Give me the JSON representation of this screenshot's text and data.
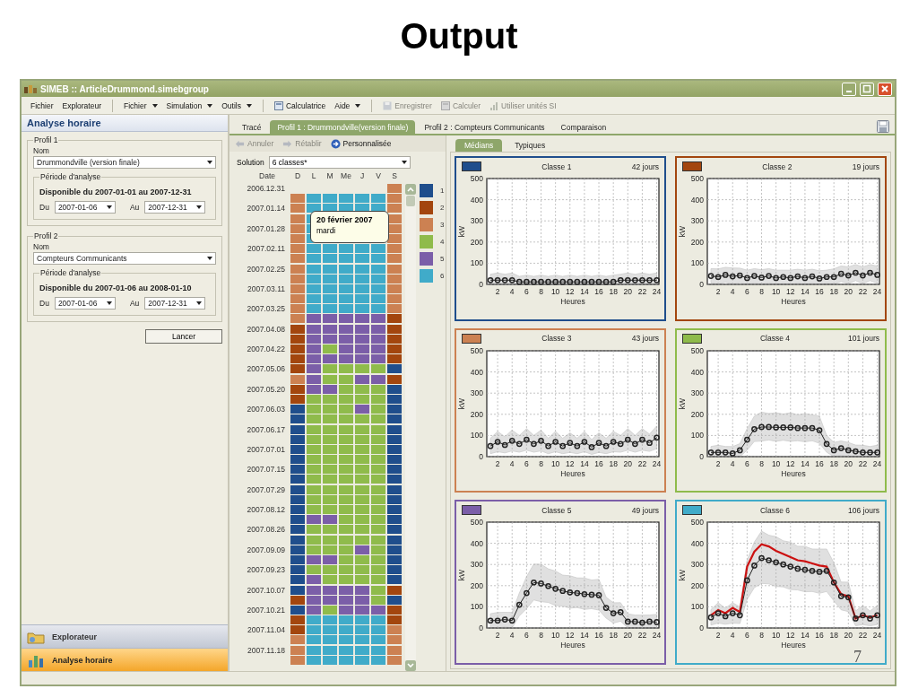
{
  "slide": {
    "title": "Output",
    "page_number": "7"
  },
  "window": {
    "title": "SIMEB :: ArticleDrummond.simebgroup"
  },
  "toolbar_groups": [
    [
      {
        "label": "Fichier",
        "kind": "plain",
        "disabled": false
      },
      {
        "label": "Explorateur",
        "kind": "plain",
        "disabled": false
      }
    ],
    [
      {
        "label": "Fichier",
        "kind": "menu",
        "disabled": false
      },
      {
        "label": "Simulation",
        "kind": "menu",
        "disabled": false
      },
      {
        "label": "Outils",
        "kind": "menu",
        "disabled": false
      }
    ],
    [
      {
        "label": "Calculatrice",
        "kind": "calculator",
        "disabled": false
      },
      {
        "label": "Aide",
        "kind": "menu",
        "disabled": false
      }
    ],
    [
      {
        "label": "Enregistrer",
        "kind": "save",
        "disabled": true
      },
      {
        "label": "Calculer",
        "kind": "calculator",
        "disabled": true
      },
      {
        "label": "Utiliser unités SI",
        "kind": "bars",
        "disabled": true
      }
    ]
  ],
  "left_panel": {
    "title": "Analyse horaire",
    "profiles": [
      {
        "legend": "Profil 1",
        "name_label": "Nom",
        "name_value": "Drummondville (version finale)",
        "period_legend": "Période d'analyse",
        "available": "Disponible du 2007-01-01 au 2007-12-31",
        "from_label": "Du",
        "from_value": "2007-01-06",
        "to_label": "Au",
        "to_value": "2007-12-31"
      },
      {
        "legend": "Profil 2",
        "name_label": "Nom",
        "name_value": "Compteurs Communicants",
        "period_legend": "Période d'analyse",
        "available": "Disponible du 2007-01-06 au 2008-01-10",
        "from_label": "Du",
        "from_value": "2007-01-06",
        "to_label": "Au",
        "to_value": "2007-12-31"
      }
    ],
    "run_button": "Lancer"
  },
  "nav": [
    {
      "label": "Explorateur",
      "selected": false
    },
    {
      "label": "Analyse horaire",
      "selected": true
    }
  ],
  "tabs": [
    {
      "label": "Tracé",
      "selected": false
    },
    {
      "label": "Profil 1 : Drummondville(version finale)",
      "selected": true
    },
    {
      "label": "Profil 2 : Compteurs Communicants",
      "selected": false
    },
    {
      "label": "Comparaison",
      "selected": false
    }
  ],
  "actions": [
    {
      "label": "Annuler",
      "kind": "undo",
      "disabled": true
    },
    {
      "label": "Rétablir",
      "kind": "redo",
      "disabled": true
    },
    {
      "label": "Personnalisée",
      "kind": "custom",
      "disabled": false
    }
  ],
  "solution": {
    "label": "Solution",
    "value": "6 classes*"
  },
  "calendar": {
    "date_header": "Date",
    "day_headers": [
      "D",
      "L",
      "M",
      "Me",
      "J",
      "V",
      "S"
    ],
    "weeks": [
      {
        "label": "2006.12.31",
        "end_days": [
          {
            "color": "#cc8152"
          }
        ]
      },
      {
        "days": [
          {
            "color": "#cc8152"
          },
          {
            "color": "#40abc9"
          },
          {
            "color": "#40abc9"
          },
          {
            "color": "#40abc9"
          },
          {
            "color": "#40abc9"
          },
          {
            "color": "#40abc9"
          },
          {
            "color": "#cc8152"
          }
        ]
      },
      {
        "label": "2007.01.14",
        "days": [
          {
            "color": "#cc8152"
          },
          {
            "color": "#40abc9"
          },
          {
            "color": "#40abc9"
          },
          {
            "color": "#40abc9"
          },
          {
            "color": "#40abc9"
          },
          {
            "color": "#40abc9"
          },
          {
            "color": "#cc8152"
          }
        ]
      },
      {
        "days": [
          {
            "color": "#cc8152"
          },
          {
            "color": "#40abc9"
          }
        ],
        "end_days": [
          {
            "color": "#cc8152"
          }
        ]
      },
      {
        "label": "2007.01.28",
        "days": [
          {
            "color": "#cc8152"
          },
          {
            "color": "#40abc9"
          }
        ],
        "end_days": [
          {
            "color": "#cc8152"
          }
        ]
      },
      {
        "days": [
          {
            "color": "#cc8152"
          },
          {
            "color": "#40abc9"
          }
        ],
        "end_days": [
          {
            "color": "#cc8152"
          }
        ]
      },
      {
        "label": "2007.02.11",
        "days": [
          {
            "color": "#cc8152"
          },
          {
            "color": "#40abc9"
          },
          {
            "color": "#40abc9"
          },
          {
            "color": "#40abc9"
          },
          {
            "color": "#40abc9"
          },
          {
            "color": "#40abc9"
          },
          {
            "color": "#cc8152"
          }
        ]
      },
      {
        "days": [
          {
            "color": "#cc8152"
          },
          {
            "color": "#40abc9"
          },
          {
            "color": "#40abc9"
          },
          {
            "color": "#40abc9"
          },
          {
            "color": "#40abc9"
          },
          {
            "color": "#40abc9"
          },
          {
            "color": "#cc8152"
          }
        ]
      },
      {
        "label": "2007.02.25",
        "days": [
          {
            "color": "#cc8152"
          },
          {
            "color": "#40abc9"
          },
          {
            "color": "#40abc9"
          },
          {
            "color": "#40abc9"
          },
          {
            "color": "#40abc9"
          },
          {
            "color": "#40abc9"
          },
          {
            "color": "#cc8152"
          }
        ]
      },
      {
        "days": [
          {
            "color": "#cc8152"
          },
          {
            "color": "#40abc9"
          },
          {
            "color": "#40abc9"
          },
          {
            "color": "#40abc9"
          },
          {
            "color": "#40abc9"
          },
          {
            "color": "#40abc9"
          },
          {
            "color": "#cc8152"
          }
        ]
      },
      {
        "label": "2007.03.11",
        "days": [
          {
            "color": "#cc8152"
          },
          {
            "color": "#40abc9"
          },
          {
            "color": "#40abc9"
          },
          {
            "color": "#40abc9"
          },
          {
            "color": "#40abc9"
          },
          {
            "color": "#40abc9"
          },
          {
            "color": "#cc8152"
          }
        ]
      },
      {
        "days": [
          {
            "color": "#cc8152"
          },
          {
            "color": "#40abc9"
          },
          {
            "color": "#40abc9"
          },
          {
            "color": "#40abc9"
          },
          {
            "color": "#40abc9"
          },
          {
            "color": "#40abc9"
          },
          {
            "color": "#cc8152"
          }
        ]
      },
      {
        "label": "2007.03.25",
        "days": [
          {
            "color": "#cc8152"
          },
          {
            "color": "#40abc9"
          },
          {
            "color": "#40abc9"
          },
          {
            "color": "#40abc9"
          },
          {
            "color": "#40abc9"
          },
          {
            "color": "#40abc9"
          },
          {
            "color": "#cc8152"
          }
        ]
      },
      {
        "days": [
          {
            "color": "#cc8152"
          },
          {
            "color": "#7b5ea8"
          },
          {
            "color": "#7b5ea8"
          },
          {
            "color": "#7b5ea8"
          },
          {
            "color": "#7b5ea8"
          },
          {
            "color": "#7b5ea8"
          },
          {
            "color": "#a3460e"
          }
        ]
      },
      {
        "label": "2007.04.08",
        "days": [
          {
            "color": "#a3460e"
          },
          {
            "color": "#7b5ea8"
          },
          {
            "color": "#7b5ea8"
          },
          {
            "color": "#7b5ea8"
          },
          {
            "color": "#7b5ea8"
          },
          {
            "color": "#7b5ea8"
          },
          {
            "color": "#a3460e"
          }
        ]
      },
      {
        "days": [
          {
            "color": "#a3460e"
          },
          {
            "color": "#7b5ea8"
          },
          {
            "color": "#7b5ea8"
          },
          {
            "color": "#7b5ea8"
          },
          {
            "color": "#7b5ea8"
          },
          {
            "color": "#7b5ea8"
          },
          {
            "color": "#a3460e"
          }
        ]
      },
      {
        "label": "2007.04.22",
        "days": [
          {
            "color": "#a3460e"
          },
          {
            "color": "#7b5ea8"
          },
          {
            "color": "#8fbb4b"
          },
          {
            "color": "#7b5ea8"
          },
          {
            "color": "#7b5ea8"
          },
          {
            "color": "#7b5ea8"
          },
          {
            "color": "#a3460e"
          }
        ]
      },
      {
        "days": [
          {
            "color": "#a3460e"
          },
          {
            "color": "#7b5ea8"
          },
          {
            "color": "#7b5ea8"
          },
          {
            "color": "#7b5ea8"
          },
          {
            "color": "#7b5ea8"
          },
          {
            "color": "#7b5ea8"
          },
          {
            "color": "#a3460e"
          }
        ]
      },
      {
        "label": "2007.05.06",
        "days": [
          {
            "color": "#a3460e"
          },
          {
            "color": "#7b5ea8"
          },
          {
            "color": "#8fbb4b"
          },
          {
            "color": "#8fbb4b"
          },
          {
            "color": "#8fbb4b"
          },
          {
            "color": "#8fbb4b"
          },
          {
            "color": "#1f4e8c"
          }
        ]
      },
      {
        "days": [
          {
            "color": "#cc8152"
          },
          {
            "color": "#7b5ea8"
          },
          {
            "color": "#8fbb4b"
          },
          {
            "color": "#8fbb4b"
          },
          {
            "color": "#7b5ea8"
          },
          {
            "color": "#7b5ea8"
          },
          {
            "color": "#a3460e"
          }
        ]
      },
      {
        "label": "2007.05.20",
        "days": [
          {
            "color": "#a3460e"
          },
          {
            "color": "#7b5ea8"
          },
          {
            "color": "#7b5ea8"
          },
          {
            "color": "#8fbb4b"
          },
          {
            "color": "#8fbb4b"
          },
          {
            "color": "#8fbb4b"
          },
          {
            "color": "#1f4e8c"
          }
        ]
      },
      {
        "days": [
          {
            "color": "#a3460e"
          },
          {
            "color": "#8fbb4b"
          },
          {
            "color": "#8fbb4b"
          },
          {
            "color": "#8fbb4b"
          },
          {
            "color": "#8fbb4b"
          },
          {
            "color": "#8fbb4b"
          },
          {
            "color": "#1f4e8c"
          }
        ]
      },
      {
        "label": "2007.06.03",
        "days": [
          {
            "color": "#1f4e8c"
          },
          {
            "color": "#8fbb4b"
          },
          {
            "color": "#8fbb4b"
          },
          {
            "color": "#8fbb4b"
          },
          {
            "color": "#7b5ea8"
          },
          {
            "color": "#8fbb4b"
          },
          {
            "color": "#1f4e8c"
          }
        ]
      },
      {
        "days": [
          {
            "color": "#1f4e8c"
          },
          {
            "color": "#8fbb4b"
          },
          {
            "color": "#8fbb4b"
          },
          {
            "color": "#8fbb4b"
          },
          {
            "color": "#8fbb4b"
          },
          {
            "color": "#8fbb4b"
          },
          {
            "color": "#1f4e8c"
          }
        ]
      },
      {
        "label": "2007.06.17",
        "days": [
          {
            "color": "#1f4e8c"
          },
          {
            "color": "#8fbb4b"
          },
          {
            "color": "#8fbb4b"
          },
          {
            "color": "#8fbb4b"
          },
          {
            "color": "#8fbb4b"
          },
          {
            "color": "#8fbb4b"
          },
          {
            "color": "#1f4e8c"
          }
        ]
      },
      {
        "days": [
          {
            "color": "#1f4e8c"
          },
          {
            "color": "#8fbb4b"
          },
          {
            "color": "#8fbb4b"
          },
          {
            "color": "#8fbb4b"
          },
          {
            "color": "#8fbb4b"
          },
          {
            "color": "#8fbb4b"
          },
          {
            "color": "#1f4e8c"
          }
        ]
      },
      {
        "label": "2007.07.01",
        "days": [
          {
            "color": "#1f4e8c"
          },
          {
            "color": "#8fbb4b"
          },
          {
            "color": "#8fbb4b"
          },
          {
            "color": "#8fbb4b"
          },
          {
            "color": "#8fbb4b"
          },
          {
            "color": "#8fbb4b"
          },
          {
            "color": "#1f4e8c"
          }
        ]
      },
      {
        "days": [
          {
            "color": "#1f4e8c"
          },
          {
            "color": "#8fbb4b"
          },
          {
            "color": "#8fbb4b"
          },
          {
            "color": "#8fbb4b"
          },
          {
            "color": "#8fbb4b"
          },
          {
            "color": "#8fbb4b"
          },
          {
            "color": "#1f4e8c"
          }
        ]
      },
      {
        "label": "2007.07.15",
        "days": [
          {
            "color": "#1f4e8c"
          },
          {
            "color": "#8fbb4b"
          },
          {
            "color": "#8fbb4b"
          },
          {
            "color": "#8fbb4b"
          },
          {
            "color": "#8fbb4b"
          },
          {
            "color": "#8fbb4b"
          },
          {
            "color": "#1f4e8c"
          }
        ]
      },
      {
        "days": [
          {
            "color": "#1f4e8c"
          },
          {
            "color": "#8fbb4b"
          },
          {
            "color": "#8fbb4b"
          },
          {
            "color": "#8fbb4b"
          },
          {
            "color": "#8fbb4b"
          },
          {
            "color": "#8fbb4b"
          },
          {
            "color": "#1f4e8c"
          }
        ]
      },
      {
        "label": "2007.07.29",
        "days": [
          {
            "color": "#1f4e8c"
          },
          {
            "color": "#8fbb4b"
          },
          {
            "color": "#8fbb4b"
          },
          {
            "color": "#8fbb4b"
          },
          {
            "color": "#8fbb4b"
          },
          {
            "color": "#8fbb4b"
          },
          {
            "color": "#1f4e8c"
          }
        ]
      },
      {
        "days": [
          {
            "color": "#1f4e8c"
          },
          {
            "color": "#8fbb4b"
          },
          {
            "color": "#8fbb4b"
          },
          {
            "color": "#8fbb4b"
          },
          {
            "color": "#8fbb4b"
          },
          {
            "color": "#8fbb4b"
          },
          {
            "color": "#1f4e8c"
          }
        ]
      },
      {
        "label": "2007.08.12",
        "days": [
          {
            "color": "#1f4e8c"
          },
          {
            "color": "#8fbb4b"
          },
          {
            "color": "#8fbb4b"
          },
          {
            "color": "#8fbb4b"
          },
          {
            "color": "#8fbb4b"
          },
          {
            "color": "#8fbb4b"
          },
          {
            "color": "#1f4e8c"
          }
        ]
      },
      {
        "days": [
          {
            "color": "#1f4e8c"
          },
          {
            "color": "#7b5ea8"
          },
          {
            "color": "#7b5ea8"
          },
          {
            "color": "#8fbb4b"
          },
          {
            "color": "#8fbb4b"
          },
          {
            "color": "#8fbb4b"
          },
          {
            "color": "#1f4e8c"
          }
        ]
      },
      {
        "label": "2007.08.26",
        "days": [
          {
            "color": "#1f4e8c"
          },
          {
            "color": "#8fbb4b"
          },
          {
            "color": "#8fbb4b"
          },
          {
            "color": "#8fbb4b"
          },
          {
            "color": "#8fbb4b"
          },
          {
            "color": "#8fbb4b"
          },
          {
            "color": "#1f4e8c"
          }
        ]
      },
      {
        "days": [
          {
            "color": "#1f4e8c"
          },
          {
            "color": "#8fbb4b"
          },
          {
            "color": "#8fbb4b"
          },
          {
            "color": "#8fbb4b"
          },
          {
            "color": "#8fbb4b"
          },
          {
            "color": "#8fbb4b"
          },
          {
            "color": "#1f4e8c"
          }
        ]
      },
      {
        "label": "2007.09.09",
        "days": [
          {
            "color": "#1f4e8c"
          },
          {
            "color": "#8fbb4b"
          },
          {
            "color": "#8fbb4b"
          },
          {
            "color": "#8fbb4b"
          },
          {
            "color": "#7b5ea8"
          },
          {
            "color": "#8fbb4b"
          },
          {
            "color": "#1f4e8c"
          }
        ]
      },
      {
        "days": [
          {
            "color": "#1f4e8c"
          },
          {
            "color": "#7b5ea8"
          },
          {
            "color": "#7b5ea8"
          },
          {
            "color": "#8fbb4b"
          },
          {
            "color": "#8fbb4b"
          },
          {
            "color": "#8fbb4b"
          },
          {
            "color": "#1f4e8c"
          }
        ]
      },
      {
        "label": "2007.09.23",
        "days": [
          {
            "color": "#1f4e8c"
          },
          {
            "color": "#8fbb4b"
          },
          {
            "color": "#8fbb4b"
          },
          {
            "color": "#8fbb4b"
          },
          {
            "color": "#8fbb4b"
          },
          {
            "color": "#8fbb4b"
          },
          {
            "color": "#1f4e8c"
          }
        ]
      },
      {
        "days": [
          {
            "color": "#1f4e8c"
          },
          {
            "color": "#7b5ea8"
          },
          {
            "color": "#8fbb4b"
          },
          {
            "color": "#8fbb4b"
          },
          {
            "color": "#8fbb4b"
          },
          {
            "color": "#8fbb4b"
          },
          {
            "color": "#1f4e8c"
          }
        ]
      },
      {
        "label": "2007.10.07",
        "days": [
          {
            "color": "#1f4e8c"
          },
          {
            "color": "#7b5ea8"
          },
          {
            "color": "#7b5ea8"
          },
          {
            "color": "#7b5ea8"
          },
          {
            "color": "#7b5ea8"
          },
          {
            "color": "#8fbb4b"
          },
          {
            "color": "#a3460e"
          }
        ]
      },
      {
        "days": [
          {
            "color": "#a3460e"
          },
          {
            "color": "#7b5ea8"
          },
          {
            "color": "#7b5ea8"
          },
          {
            "color": "#7b5ea8"
          },
          {
            "color": "#7b5ea8"
          },
          {
            "color": "#8fbb4b"
          },
          {
            "color": "#1f4e8c"
          }
        ]
      },
      {
        "label": "2007.10.21",
        "days": [
          {
            "color": "#1f4e8c"
          },
          {
            "color": "#7b5ea8"
          },
          {
            "color": "#8fbb4b"
          },
          {
            "color": "#7b5ea8"
          },
          {
            "color": "#7b5ea8"
          },
          {
            "color": "#7b5ea8"
          },
          {
            "color": "#a3460e"
          }
        ]
      },
      {
        "days": [
          {
            "color": "#a3460e"
          },
          {
            "color": "#40abc9"
          },
          {
            "color": "#40abc9"
          },
          {
            "color": "#40abc9"
          },
          {
            "color": "#40abc9"
          },
          {
            "color": "#40abc9"
          },
          {
            "color": "#a3460e"
          }
        ]
      },
      {
        "label": "2007.11.04",
        "days": [
          {
            "color": "#a3460e"
          },
          {
            "color": "#40abc9"
          },
          {
            "color": "#40abc9"
          },
          {
            "color": "#40abc9"
          },
          {
            "color": "#40abc9"
          },
          {
            "color": "#40abc9"
          },
          {
            "color": "#cc8152"
          }
        ]
      },
      {
        "days": [
          {
            "color": "#cc8152"
          },
          {
            "color": "#40abc9"
          },
          {
            "color": "#40abc9"
          },
          {
            "color": "#40abc9"
          },
          {
            "color": "#40abc9"
          },
          {
            "color": "#40abc9"
          },
          {
            "color": "#cc8152"
          }
        ]
      },
      {
        "label": "2007.11.18",
        "days": [
          {
            "color": "#cc8152"
          },
          {
            "color": "#40abc9"
          },
          {
            "color": "#40abc9"
          },
          {
            "color": "#40abc9"
          },
          {
            "color": "#40abc9"
          },
          {
            "color": "#40abc9"
          },
          {
            "color": "#cc8152"
          }
        ]
      },
      {
        "days": [
          {
            "color": "#cc8152"
          },
          {
            "color": "#40abc9"
          },
          {
            "color": "#40abc9"
          },
          {
            "color": "#40abc9"
          },
          {
            "color": "#40abc9"
          },
          {
            "color": "#40abc9"
          },
          {
            "color": "#cc8152"
          }
        ]
      }
    ]
  },
  "tooltip": {
    "title": "20 février 2007",
    "subtitle": "mardi"
  },
  "legend": [
    {
      "label": "1",
      "color": "#1f4e8c"
    },
    {
      "label": "2",
      "color": "#a3460e"
    },
    {
      "label": "3",
      "color": "#cc8152"
    },
    {
      "label": "4",
      "color": "#8fbb4b"
    },
    {
      "label": "5",
      "color": "#7b5ea8"
    },
    {
      "label": "6",
      "color": "#40abc9"
    }
  ],
  "chart_tabs": [
    {
      "label": "Médians",
      "selected": true
    },
    {
      "label": "Typiques",
      "selected": false
    }
  ],
  "panels": [
    {
      "title": "Classe 1",
      "count": "42 jours",
      "color": "#1f4e8c",
      "chart_data": {
        "type": "line",
        "xlabel": "Heures",
        "ylabel": "kW",
        "x": [
          1,
          2,
          3,
          4,
          5,
          6,
          7,
          8,
          9,
          10,
          11,
          12,
          13,
          14,
          15,
          16,
          17,
          18,
          19,
          20,
          21,
          22,
          23,
          24
        ],
        "xlim": [
          0.5,
          24.3
        ],
        "ylim": [
          0,
          500
        ],
        "xticks": [
          2,
          4,
          6,
          8,
          10,
          12,
          14,
          16,
          18,
          20,
          22,
          24
        ],
        "yticks": [
          0,
          100,
          200,
          300,
          400,
          500
        ],
        "grid": true,
        "series": [
          {
            "color": "#222222",
            "marker": "o",
            "values": [
              20,
              20,
              20,
              20,
              12,
              12,
              12,
              12,
              12,
              12,
              12,
              12,
              12,
              12,
              12,
              12,
              12,
              12,
              20,
              20,
              20,
              20,
              20,
              20
            ]
          }
        ]
      }
    },
    {
      "title": "Classe 2",
      "count": "19 jours",
      "color": "#a3460e",
      "chart_data": {
        "type": "line",
        "xlabel": "Heures",
        "ylabel": "kW",
        "x": [
          1,
          2,
          3,
          4,
          5,
          6,
          7,
          8,
          9,
          10,
          11,
          12,
          13,
          14,
          15,
          16,
          17,
          18,
          19,
          20,
          21,
          22,
          23,
          24
        ],
        "xlim": [
          0.5,
          24.3
        ],
        "ylim": [
          0,
          500
        ],
        "xticks": [
          2,
          4,
          6,
          8,
          10,
          12,
          14,
          16,
          18,
          20,
          22,
          24
        ],
        "yticks": [
          0,
          100,
          200,
          300,
          400,
          500
        ],
        "grid": true,
        "series": [
          {
            "color": "#222222",
            "marker": "o",
            "values": [
              40,
              35,
              45,
              38,
              42,
              30,
              40,
              32,
              40,
              30,
              35,
              30,
              38,
              30,
              38,
              28,
              35,
              35,
              50,
              42,
              55,
              42,
              55,
              45
            ]
          }
        ]
      }
    },
    {
      "title": "Classe 3",
      "count": "43 jours",
      "color": "#cc8152",
      "chart_data": {
        "type": "line",
        "xlabel": "Heures",
        "ylabel": "kW",
        "x": [
          1,
          2,
          3,
          4,
          5,
          6,
          7,
          8,
          9,
          10,
          11,
          12,
          13,
          14,
          15,
          16,
          17,
          18,
          19,
          20,
          21,
          22,
          23,
          24
        ],
        "xlim": [
          0.5,
          24.3
        ],
        "ylim": [
          0,
          500
        ],
        "xticks": [
          2,
          4,
          6,
          8,
          10,
          12,
          14,
          16,
          18,
          20,
          22,
          24
        ],
        "yticks": [
          0,
          100,
          200,
          300,
          400,
          500
        ],
        "grid": true,
        "series": [
          {
            "color": "#222222",
            "marker": "o",
            "values": [
              50,
              70,
              55,
              75,
              60,
              80,
              60,
              75,
              50,
              70,
              50,
              65,
              50,
              70,
              45,
              65,
              50,
              70,
              60,
              80,
              60,
              80,
              65,
              90
            ]
          }
        ]
      }
    },
    {
      "title": "Classe 4",
      "count": "101 jours",
      "color": "#8fbb4b",
      "chart_data": {
        "type": "line",
        "xlabel": "Heures",
        "ylabel": "kW",
        "x": [
          1,
          2,
          3,
          4,
          5,
          6,
          7,
          8,
          9,
          10,
          11,
          12,
          13,
          14,
          15,
          16,
          17,
          18,
          19,
          20,
          21,
          22,
          23,
          24
        ],
        "xlim": [
          0.5,
          24.3
        ],
        "ylim": [
          0,
          500
        ],
        "xticks": [
          2,
          4,
          6,
          8,
          10,
          12,
          14,
          16,
          18,
          20,
          22,
          24
        ],
        "yticks": [
          0,
          100,
          200,
          300,
          400,
          500
        ],
        "grid": true,
        "series": [
          {
            "color": "#222222",
            "marker": "o",
            "values": [
              20,
              20,
              20,
              15,
              30,
              80,
              130,
              140,
              140,
              138,
              138,
              138,
              135,
              135,
              135,
              125,
              60,
              30,
              40,
              30,
              25,
              20,
              20,
              20
            ]
          }
        ]
      }
    },
    {
      "title": "Classe 5",
      "count": "49 jours",
      "color": "#7b5ea8",
      "chart_data": {
        "type": "line",
        "xlabel": "Heures",
        "ylabel": "kW",
        "x": [
          1,
          2,
          3,
          4,
          5,
          6,
          7,
          8,
          9,
          10,
          11,
          12,
          13,
          14,
          15,
          16,
          17,
          18,
          19,
          20,
          21,
          22,
          23,
          24
        ],
        "xlim": [
          0.5,
          24.3
        ],
        "ylim": [
          0,
          500
        ],
        "xticks": [
          2,
          4,
          6,
          8,
          10,
          12,
          14,
          16,
          18,
          20,
          22,
          24
        ],
        "yticks": [
          0,
          100,
          200,
          300,
          400,
          500
        ],
        "grid": true,
        "series": [
          {
            "color": "#222222",
            "marker": "o",
            "values": [
              35,
              35,
              40,
              35,
              110,
              165,
              215,
              210,
              198,
              185,
              175,
              168,
              165,
              160,
              157,
              155,
              95,
              70,
              75,
              30,
              30,
              25,
              30,
              28
            ]
          }
        ]
      }
    },
    {
      "title": "Classe 6",
      "count": "106 jours",
      "color": "#40abc9",
      "chart_data": {
        "type": "line",
        "xlabel": "Heures",
        "ylabel": "kW",
        "x": [
          1,
          2,
          3,
          4,
          5,
          6,
          7,
          8,
          9,
          10,
          11,
          12,
          13,
          14,
          15,
          16,
          17,
          18,
          19,
          20,
          21,
          22,
          23,
          24
        ],
        "xlim": [
          0.5,
          24.3
        ],
        "ylim": [
          0,
          500
        ],
        "xticks": [
          2,
          4,
          6,
          8,
          10,
          12,
          14,
          16,
          18,
          20,
          22,
          24
        ],
        "yticks": [
          0,
          100,
          200,
          300,
          400,
          500
        ],
        "grid": true,
        "series": [
          {
            "color": "#cc1111",
            "values": [
              60,
              85,
              70,
              95,
              75,
              290,
              360,
              395,
              385,
              365,
              350,
              335,
              320,
              315,
              305,
              295,
              290,
              215,
              160,
              150,
              45,
              60,
              50,
              60
            ]
          },
          {
            "color": "#222222",
            "marker": "o",
            "values": [
              50,
              70,
              55,
              70,
              60,
              225,
              295,
              330,
              320,
              310,
              300,
              290,
              280,
              275,
              270,
              265,
              270,
              215,
              150,
              145,
              45,
              60,
              45,
              60
            ]
          }
        ]
      }
    }
  ]
}
